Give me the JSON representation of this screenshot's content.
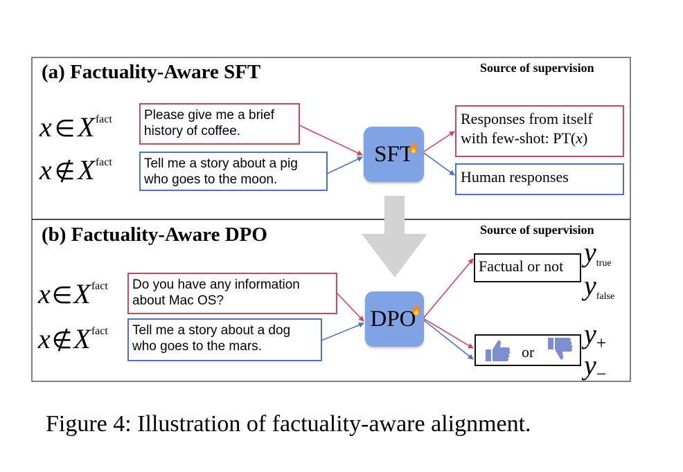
{
  "figure": {
    "caption": "Figure 4: Illustration of factuality-aware alignment.",
    "colors": {
      "fact_red": "#d2435f",
      "nonfact_blue": "#4a72c8",
      "model_box": "#7fa3e4",
      "down_arrow_gray": "#d3d3d3",
      "thumb": "#7b8fd0",
      "flame": "#f08a2c"
    }
  },
  "panel_a": {
    "title": "(a) Factuality-Aware SFT",
    "source_title": "Source of supervision",
    "conditions": [
      {
        "var": "x",
        "op": "∈",
        "set": "X",
        "sup": "fact"
      },
      {
        "var": "x",
        "op": "∉",
        "set": "X",
        "sup": "fact"
      }
    ],
    "prompts": [
      {
        "line1": "Please give me a brief",
        "line2": "history of coffee.",
        "kind": "fact"
      },
      {
        "line1": "Tell me a story about a pig",
        "line2": "who goes to the moon.",
        "kind": "nonfact"
      }
    ],
    "model": {
      "label": "SFT",
      "icon": "flame-icon"
    },
    "supervision": [
      {
        "line1": "Responses from itself",
        "line2_prefix": "with few-shot: PT(",
        "line2_var": "x",
        "line2_suffix": ")",
        "kind": "fact"
      },
      {
        "line1": "Human responses",
        "kind": "nonfact"
      }
    ]
  },
  "panel_b": {
    "title": "(b) Factuality-Aware DPO",
    "source_title": "Source of supervision",
    "conditions": [
      {
        "var": "x",
        "op": "∈",
        "set": "X",
        "sup": "fact"
      },
      {
        "var": "x",
        "op": "∉",
        "set": "X",
        "sup": "fact"
      }
    ],
    "prompts": [
      {
        "line1": "Do you have any information",
        "line2": "about Mac OS?",
        "kind": "fact"
      },
      {
        "line1": "Tell me a story about a dog",
        "line2": "who goes to the mars.",
        "kind": "nonfact"
      }
    ],
    "model": {
      "label": "DPO",
      "icon": "flame-icon"
    },
    "supervision": {
      "factual_box": {
        "label": "Factual or not"
      },
      "preference_box": {
        "or_label": "or",
        "left_icon": "thumbs-up-icon",
        "right_icon": "thumbs-down-icon"
      }
    },
    "outputs": {
      "y_true": {
        "var": "y",
        "sub": "true"
      },
      "y_false": {
        "var": "y",
        "sub": "false"
      },
      "y_plus": {
        "var": "y",
        "sub": "+"
      },
      "y_minus": {
        "var": "y",
        "sub": "−"
      }
    }
  }
}
